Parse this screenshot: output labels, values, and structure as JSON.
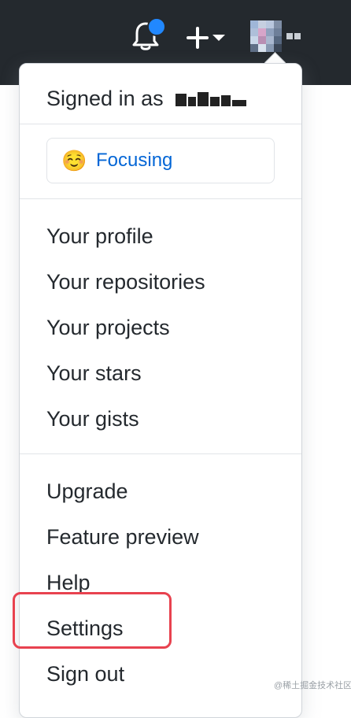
{
  "header": {
    "icons": {
      "notifications": "bell-icon",
      "create": "plus-icon",
      "create_caret": "caret-down-icon",
      "avatar": "avatar-image",
      "avatar_caret": "caret-down-icon"
    },
    "colors": {
      "background": "#24292e",
      "notification_dot": "#2188ff"
    }
  },
  "dropdown": {
    "signed_in_label": "Signed in as",
    "status": {
      "emoji": "☺️",
      "label": "Focusing"
    },
    "sections": [
      {
        "items": [
          "Your profile",
          "Your repositories",
          "Your projects",
          "Your stars",
          "Your gists"
        ]
      },
      {
        "items": [
          "Upgrade",
          "Feature preview",
          "Help",
          "Settings",
          "Sign out"
        ]
      }
    ],
    "highlighted_item": "Settings",
    "highlight_color": "#e8424f"
  },
  "watermark": "@稀土掘金技术社区"
}
